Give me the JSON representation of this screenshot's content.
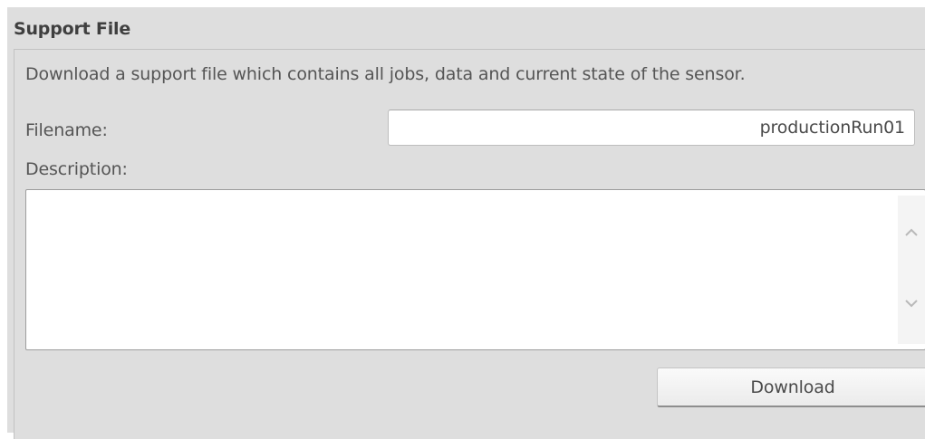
{
  "section": {
    "title": "Support File",
    "intro": "Download a support file which contains all jobs, data and current state of the sensor."
  },
  "form": {
    "filename_label": "Filename:",
    "filename_value": "productionRun01",
    "description_label": "Description:",
    "description_value": ""
  },
  "scrollbar": {
    "up_icon": "chevron-up-icon",
    "down_icon": "chevron-down-icon"
  },
  "actions": {
    "download_label": "Download"
  },
  "colors": {
    "panel_background": "#dedede",
    "text": "#555555",
    "title": "#3f3f3f",
    "input_background": "#ffffff"
  }
}
